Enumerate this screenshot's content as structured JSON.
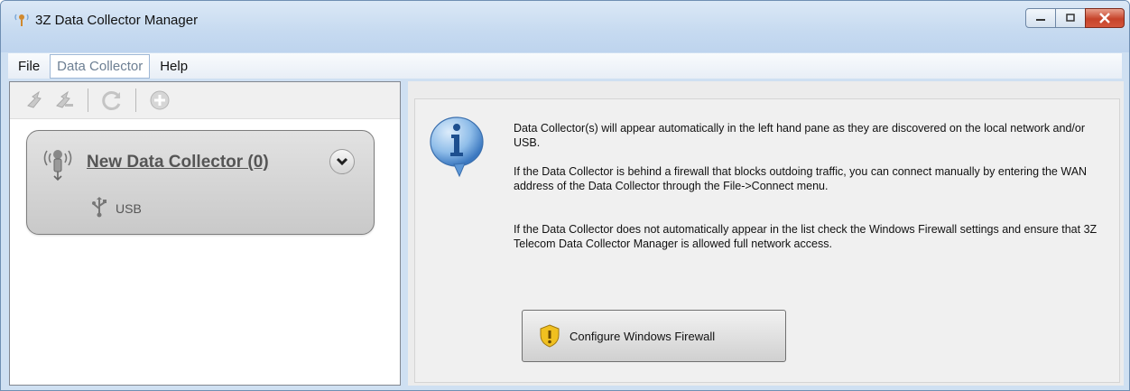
{
  "window": {
    "title": "3Z Data Collector Manager",
    "icon": "data-collector-icon"
  },
  "menubar": {
    "items": [
      "File",
      "Data Collector",
      "Help"
    ],
    "active": "Data Collector"
  },
  "toolbar": {
    "icons": [
      "add-collector-icon",
      "remove-collector-icon",
      "refresh-icon",
      "add-icon"
    ]
  },
  "collector_card": {
    "title": "New Data Collector (0)",
    "connection_label": "USB",
    "icons": [
      "wireless-collector-icon",
      "usb-icon",
      "chevron-down-icon"
    ]
  },
  "info_panel": {
    "icon": "info-icon",
    "paragraph1": "Data Collector(s) will appear automatically in the left hand pane as they are discovered on the local network and/or USB.",
    "paragraph2": "If the Data Collector is behind a firewall that blocks outdoing traffic, you can connect manually by entering the WAN address of the Data Collector through the File->Connect menu.",
    "paragraph3": "If the Data Collector does not automatically appear in the list check the Windows Firewall settings and ensure that 3Z Telecom Data Collector Manager is allowed full network access.",
    "button_label": "Configure Windows Firewall"
  },
  "colors": {
    "titlebar": "#c6daf0",
    "close_button": "#c6432a",
    "card_background": "#d4d4d4",
    "info_blue": "#2f6fb8"
  }
}
